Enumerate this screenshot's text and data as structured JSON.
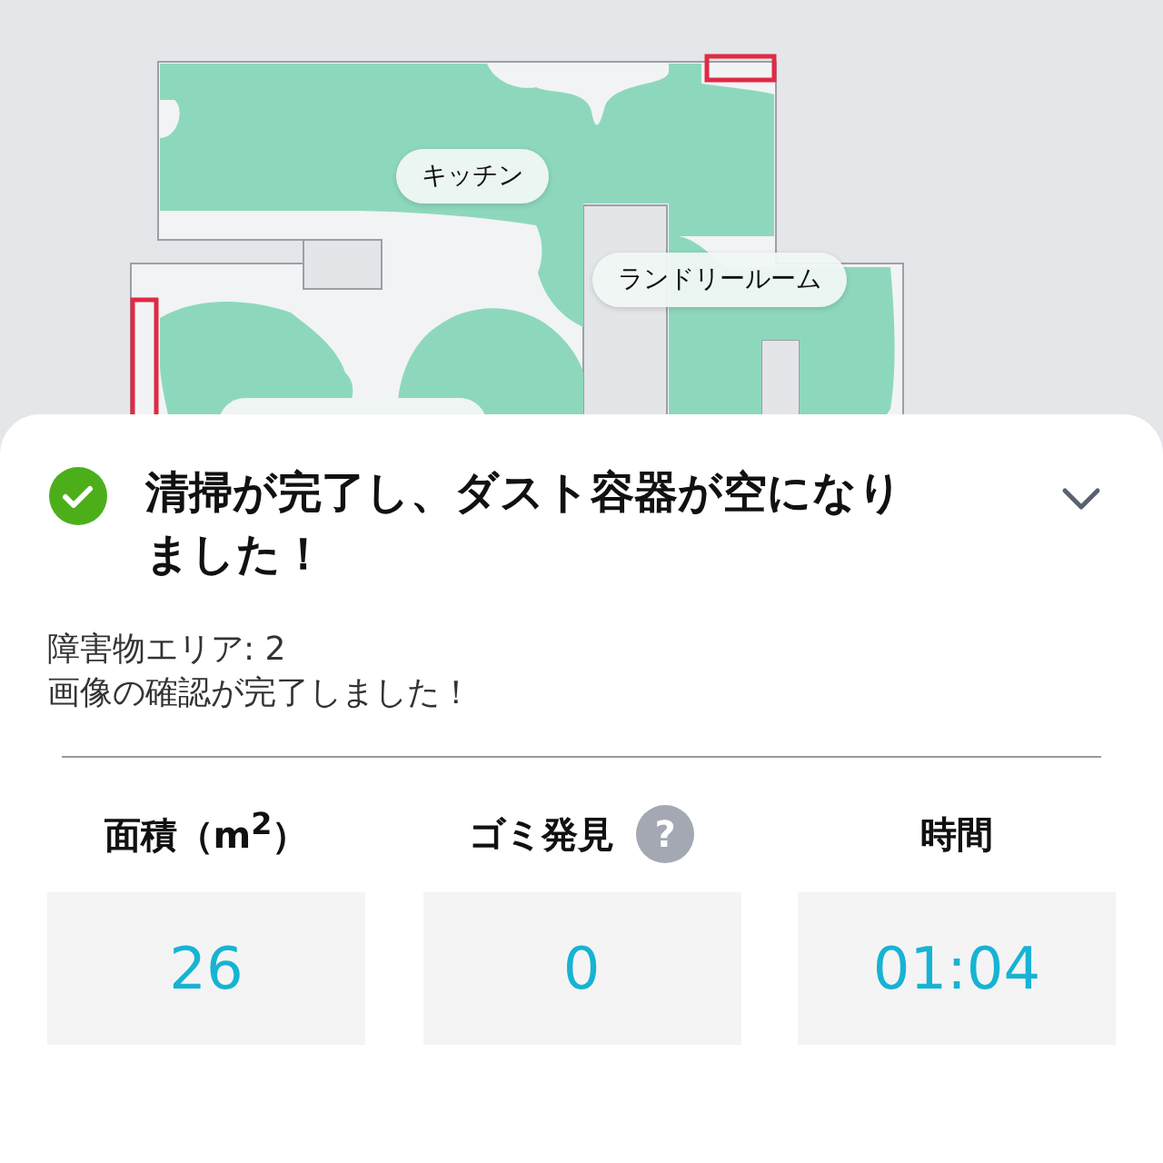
{
  "map": {
    "rooms": [
      {
        "label": "キッチン"
      },
      {
        "label": "ランドリールーム"
      }
    ]
  },
  "notice": {
    "succeeded": true,
    "title": "清掃が完了し、ダスト容器が空になりました！",
    "details": [
      "障害物エリア: 2",
      "画像の確認が完了しました！"
    ]
  },
  "stats": [
    {
      "label": "面積（m$^{2}$）",
      "value": "26"
    },
    {
      "label": "ゴミ発見",
      "value": "0",
      "help": "?"
    },
    {
      "label": "時間",
      "value": "01:04"
    }
  ]
}
